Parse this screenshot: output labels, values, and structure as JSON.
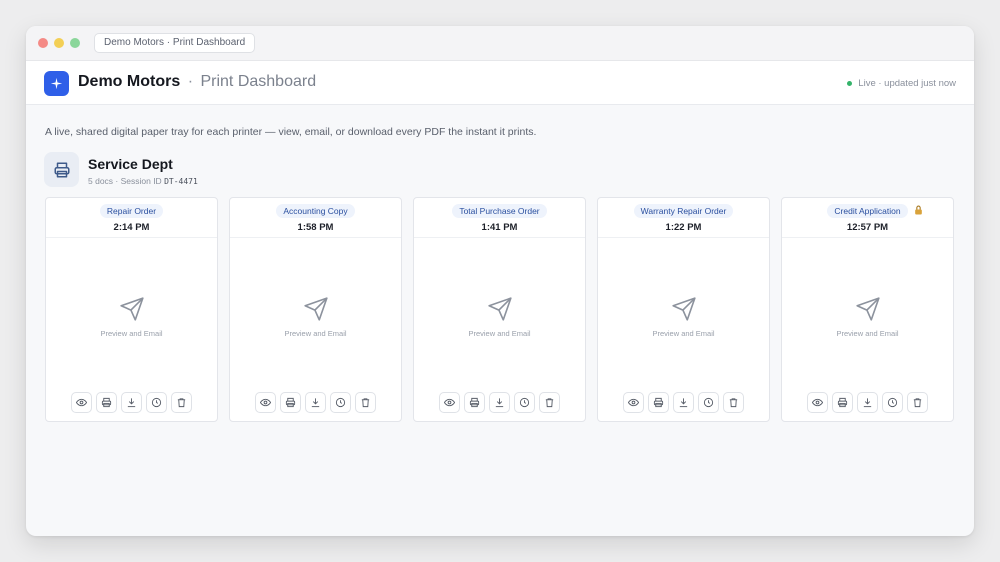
{
  "window": {
    "tab_title": "Demo Motors · Print Dashboard"
  },
  "header": {
    "brand": "Demo Motors",
    "separator": "·",
    "subtitle": "Print Dashboard",
    "live_status": "Live · updated just now",
    "live_color": "#34b36a",
    "logo_icon": "sparkle-icon",
    "accent": "#2f5fe8"
  },
  "intro": "A live, shared digital paper tray for each printer — view, email, or download every PDF the instant it prints.",
  "department": {
    "name": "Service Dept",
    "meta_prefix": "5 docs · Session ID",
    "session_id": "DT-4471",
    "icon": "printer-icon"
  },
  "documents": [
    {
      "title": "Repair Order",
      "time": "2:14 PM",
      "preview_label": "Preview and Email",
      "locked": false
    },
    {
      "title": "Accounting Copy",
      "time": "1:58 PM",
      "preview_label": "Preview and Email",
      "locked": false
    },
    {
      "title": "Total Purchase Order",
      "time": "1:41 PM",
      "preview_label": "Preview and Email",
      "locked": false
    },
    {
      "title": "Warranty Repair Order",
      "time": "1:22 PM",
      "preview_label": "Preview and Email",
      "locked": false
    },
    {
      "title": "Credit Application",
      "time": "12:57 PM",
      "preview_label": "Preview and Email",
      "locked": true
    }
  ],
  "card_actions": [
    "eye-icon",
    "printer-icon",
    "download-icon",
    "clock-icon",
    "trash-icon"
  ]
}
